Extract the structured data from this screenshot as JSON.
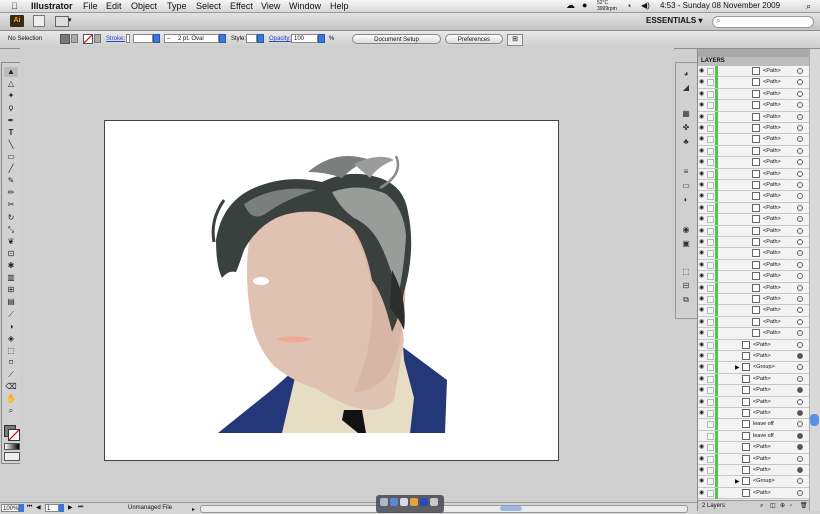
{
  "menubar": {
    "app": "Illustrator",
    "items": [
      "File",
      "Edit",
      "Object",
      "Type",
      "Select",
      "Effect",
      "View",
      "Window",
      "Help"
    ],
    "weather_temp": "52°C",
    "weather_sub": "3999rpm",
    "clock": "4:53 - Sunday 08 November 2009"
  },
  "appbar": {
    "logo": "Ai",
    "workspace": "ESSENTIALS",
    "workspace_arrow": "▾"
  },
  "control": {
    "selection": "No Selection",
    "stroke_label": "Stroke:",
    "brush_value": "2 pt. Oval",
    "style_label": "Style:",
    "opacity_label": "Opacity:",
    "opacity_value": "100",
    "opacity_unit": "%",
    "doc_setup": "Document Setup",
    "preferences": "Preferences"
  },
  "layers": {
    "title": "LAYERS",
    "footer": "2 Layers",
    "rows": [
      {
        "name": "<Path>",
        "indent": 2,
        "filled": false
      },
      {
        "name": "<Path>",
        "indent": 2,
        "filled": false
      },
      {
        "name": "<Path>",
        "indent": 2,
        "filled": false
      },
      {
        "name": "<Path>",
        "indent": 2,
        "filled": false
      },
      {
        "name": "<Path>",
        "indent": 2,
        "filled": false
      },
      {
        "name": "<Path>",
        "indent": 2,
        "filled": false
      },
      {
        "name": "<Path>",
        "indent": 2,
        "filled": false
      },
      {
        "name": "<Path>",
        "indent": 2,
        "filled": false
      },
      {
        "name": "<Path>",
        "indent": 2,
        "filled": false
      },
      {
        "name": "<Path>",
        "indent": 2,
        "filled": false
      },
      {
        "name": "<Path>",
        "indent": 2,
        "filled": false
      },
      {
        "name": "<Path>",
        "indent": 2,
        "filled": false
      },
      {
        "name": "<Path>",
        "indent": 2,
        "filled": false
      },
      {
        "name": "<Path>",
        "indent": 2,
        "filled": false
      },
      {
        "name": "<Path>",
        "indent": 2,
        "filled": false
      },
      {
        "name": "<Path>",
        "indent": 2,
        "filled": false
      },
      {
        "name": "<Path>",
        "indent": 2,
        "filled": false
      },
      {
        "name": "<Path>",
        "indent": 2,
        "filled": false
      },
      {
        "name": "<Path>",
        "indent": 2,
        "filled": false
      },
      {
        "name": "<Path>",
        "indent": 2,
        "filled": false
      },
      {
        "name": "<Path>",
        "indent": 2,
        "filled": false
      },
      {
        "name": "<Path>",
        "indent": 2,
        "filled": false
      },
      {
        "name": "<Path>",
        "indent": 2,
        "filled": false
      },
      {
        "name": "<Path>",
        "indent": 2,
        "filled": false
      },
      {
        "name": "<Path>",
        "indent": 1,
        "filled": false
      },
      {
        "name": "<Path>",
        "indent": 1,
        "filled": true
      },
      {
        "name": "<Group>",
        "indent": 1,
        "filled": false,
        "group": true
      },
      {
        "name": "<Path>",
        "indent": 1,
        "filled": false
      },
      {
        "name": "<Path>",
        "indent": 1,
        "filled": true
      },
      {
        "name": "<Path>",
        "indent": 1,
        "filled": false
      },
      {
        "name": "<Path>",
        "indent": 1,
        "filled": true
      },
      {
        "name": "leave off",
        "indent": 1,
        "filled": false,
        "hidden": true
      },
      {
        "name": "leave off",
        "indent": 1,
        "filled": true,
        "hidden": true
      },
      {
        "name": "<Path>",
        "indent": 1,
        "filled": true
      },
      {
        "name": "<Path>",
        "indent": 1,
        "filled": false
      },
      {
        "name": "<Path>",
        "indent": 1,
        "filled": true
      },
      {
        "name": "<Group>",
        "indent": 1,
        "filled": false,
        "group": true
      },
      {
        "name": "<Path>",
        "indent": 1,
        "filled": false
      }
    ]
  },
  "status": {
    "zoom": "100%",
    "page": "1",
    "file_status": "Unmanaged File"
  },
  "colors": {
    "accent": "#3a78d8",
    "layer_bar": "#4cc94c",
    "suit": "#243778",
    "skin": "#e0c2b2",
    "shirt": "#e7ddc4",
    "hair": "#3a403e"
  }
}
